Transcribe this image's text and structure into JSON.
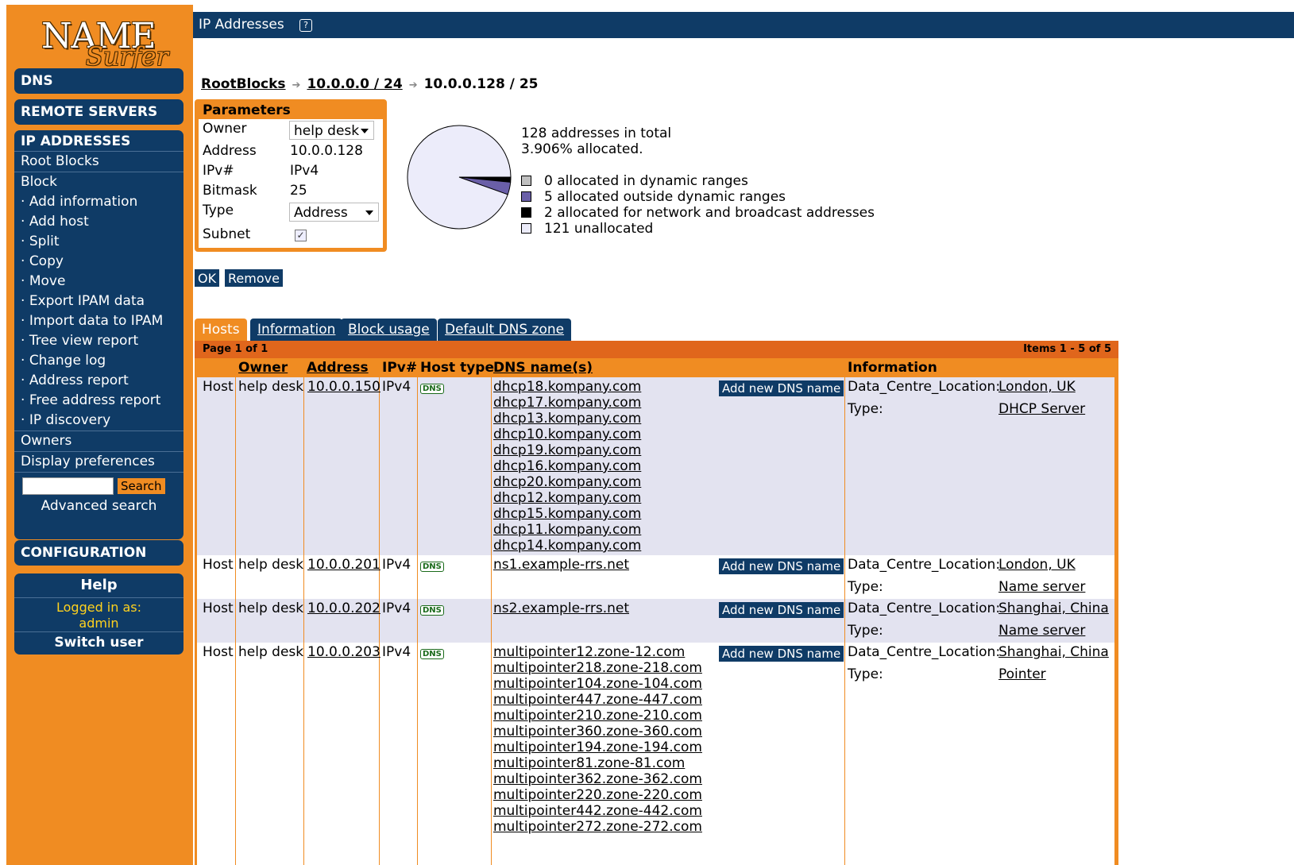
{
  "logo": {
    "word1": "NAME",
    "word2": "Surfer"
  },
  "sidebar": {
    "dns": "DNS",
    "remote_servers": "REMOTE SERVERS",
    "ip_addresses": "IP ADDRESSES",
    "root_blocks": "Root Blocks",
    "block": "Block",
    "block_items": [
      "Add information",
      "Add host",
      "Split",
      "Copy",
      "Move",
      "Export IPAM data",
      "Import data to IPAM",
      "Tree view report",
      "Change log",
      "Address report",
      "Free address report",
      "IP discovery"
    ],
    "owners": "Owners",
    "display_preferences": "Display preferences",
    "search_button": "Search",
    "search_value": "",
    "advanced_search": "Advanced search",
    "configuration": "CONFIGURATION",
    "help": "Help",
    "logged_in_label": "Logged in as:",
    "logged_in_user": "admin",
    "switch_user": "Switch user"
  },
  "header": {
    "title": "IP Addresses",
    "help_icon": "?"
  },
  "breadcrumb": {
    "root": "RootBlocks",
    "parent": "10.0.0.0 / 24",
    "current": "10.0.0.128 / 25"
  },
  "parameters": {
    "title": "Parameters",
    "owner_label": "Owner",
    "owner_value": "help desk",
    "address_label": "Address",
    "address_value": "10.0.0.128",
    "ipv_label": "IPv#",
    "ipv_value": "IPv4",
    "bitmask_label": "Bitmask",
    "bitmask_value": "25",
    "type_label": "Type",
    "type_value": "Address",
    "subnet_label": "Subnet",
    "subnet_checked": true
  },
  "usage": {
    "total_text": "128 addresses in total",
    "allocated_text": "3.906% allocated.",
    "legend": [
      {
        "label": "0 allocated in dynamic ranges",
        "color": "#c0c0c0",
        "value": 0
      },
      {
        "label": "5 allocated outside dynamic ranges",
        "color": "#6a5fa8",
        "value": 5
      },
      {
        "label": "2 allocated for network and broadcast addresses",
        "color": "#000000",
        "value": 2
      },
      {
        "label": "121 unallocated",
        "color": "#ececfa",
        "value": 121
      }
    ]
  },
  "buttons": {
    "ok": "OK",
    "remove": "Remove"
  },
  "tabs": [
    "Hosts",
    "Information",
    "Block usage",
    "Default DNS zone"
  ],
  "table": {
    "page_text": "Page 1 of 1",
    "items_text": "Items 1 - 5 of 5",
    "headers": {
      "owner": "Owner",
      "address": "Address",
      "ipv": "IPv#",
      "host_type": "Host type",
      "dns_names": "DNS name(s)",
      "information": "Information"
    },
    "add_dns_label": "Add new DNS name",
    "dns_badge": "DNS",
    "rows": [
      {
        "kind": "Host",
        "owner": "help desk",
        "address": "10.0.0.150",
        "ipv": "IPv4",
        "dns": [
          "dhcp18.kompany.com",
          "dhcp17.kompany.com",
          "dhcp13.kompany.com",
          "dhcp10.kompany.com",
          "dhcp19.kompany.com",
          "dhcp16.kompany.com",
          "dhcp20.kompany.com",
          "dhcp12.kompany.com",
          "dhcp15.kompany.com",
          "dhcp11.kompany.com",
          "dhcp14.kompany.com"
        ],
        "info": [
          {
            "key": "Data_Centre_Location:",
            "value": "London, UK"
          },
          {
            "key": "Type:",
            "value": "DHCP Server"
          }
        ]
      },
      {
        "kind": "Host",
        "owner": "help desk",
        "address": "10.0.0.201",
        "ipv": "IPv4",
        "dns": [
          "ns1.example-rrs.net"
        ],
        "info": [
          {
            "key": "Data_Centre_Location:",
            "value": "London, UK"
          },
          {
            "key": "Type:",
            "value": "Name server"
          }
        ]
      },
      {
        "kind": "Host",
        "owner": "help desk",
        "address": "10.0.0.202",
        "ipv": "IPv4",
        "dns": [
          "ns2.example-rrs.net"
        ],
        "info": [
          {
            "key": "Data_Centre_Location:",
            "value": "Shanghai, China"
          },
          {
            "key": "Type:",
            "value": "Name server"
          }
        ]
      },
      {
        "kind": "Host",
        "owner": "help desk",
        "address": "10.0.0.203",
        "ipv": "IPv4",
        "dns": [
          "multipointer12.zone-12.com",
          "multipointer218.zone-218.com",
          "multipointer104.zone-104.com",
          "multipointer447.zone-447.com",
          "multipointer210.zone-210.com",
          "multipointer360.zone-360.com",
          "multipointer194.zone-194.com",
          "multipointer81.zone-81.com",
          "multipointer362.zone-362.com",
          "multipointer220.zone-220.com",
          "multipointer442.zone-442.com",
          "multipointer272.zone-272.com"
        ],
        "info": [
          {
            "key": "Data_Centre_Location:",
            "value": "Shanghai, China"
          },
          {
            "key": "Type:",
            "value": "Pointer"
          }
        ]
      }
    ]
  }
}
